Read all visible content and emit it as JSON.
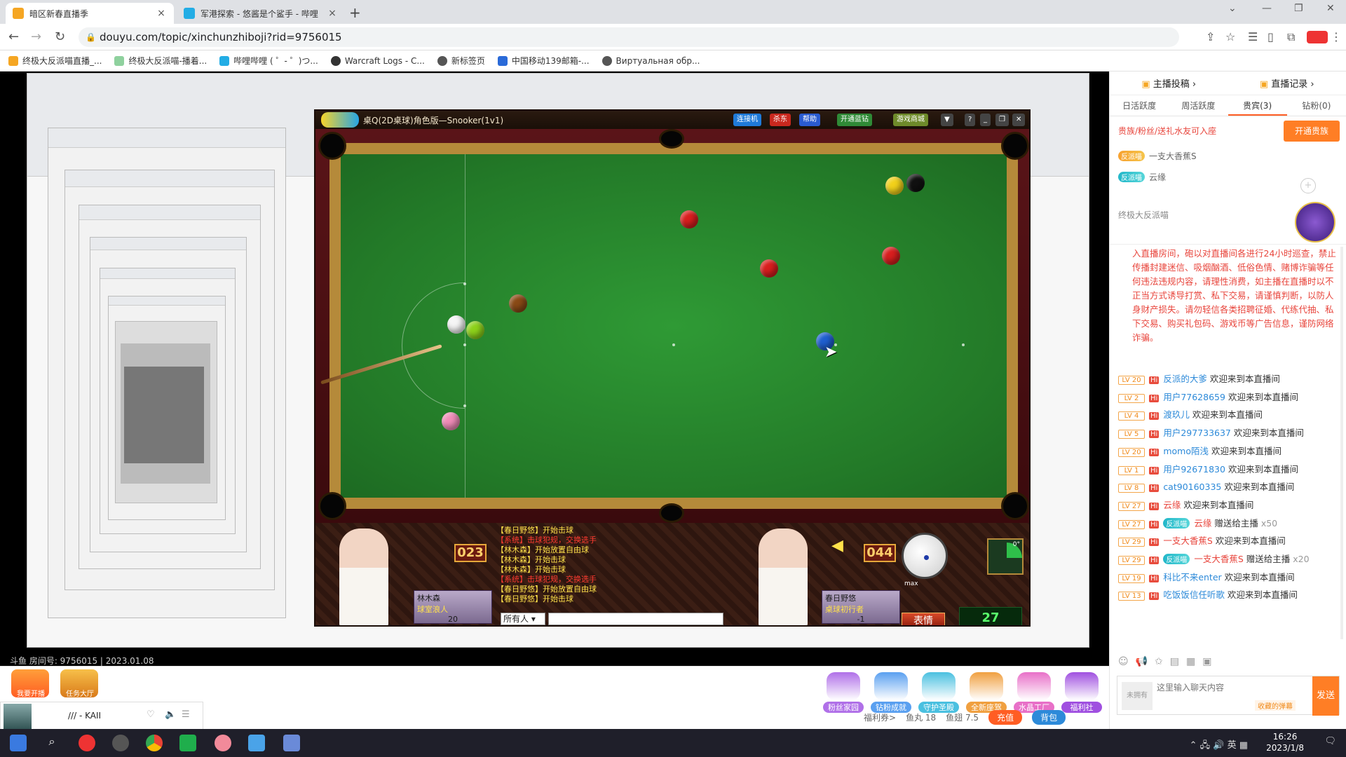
{
  "browser": {
    "tabs": [
      {
        "title": "暗区新春直播季",
        "active": true
      },
      {
        "title": "军港探索 - 悠酱是个鲨手 - 哔哩",
        "active": false
      }
    ],
    "new_tab": "+",
    "url": "douyu.com/topic/xinchunzhiboji?rid=9756015",
    "bookmarks": [
      "终极大反派喵直播_...",
      "终极大反派喵-播着...",
      "哔哩哔哩 ( ゜- ゜)つ...",
      "Warcraft Logs - C...",
      "新标签页",
      "中国移动139邮箱-...",
      "Виртуальная обр..."
    ]
  },
  "game": {
    "title": "桌Q(2D桌球)角色版—Snooker(1v1)",
    "buttons": [
      "连接机",
      "杀东",
      "帮助",
      "开通蓝钻",
      "游戏商城"
    ],
    "player_left": {
      "name": "林木森",
      "title": "球室浪人",
      "coins": "20",
      "score": "023"
    },
    "player_right": {
      "name": "春日野悠",
      "title": "桌球初行者",
      "coins": "-1",
      "score": "044"
    },
    "log": [
      {
        "text": "【春日野悠】开始击球",
        "color": "#ffe14a"
      },
      {
        "text": "【系统】击球犯规，交换选手",
        "color": "#ff3b30"
      },
      {
        "text": "【林木森】开始放置自由球",
        "color": "#ffe14a"
      },
      {
        "text": "【林木森】开始击球",
        "color": "#ffe14a"
      },
      {
        "text": "【林木森】开始击球",
        "color": "#ffe14a"
      },
      {
        "text": "【系统】击球犯规，交换选手",
        "color": "#ff3b30"
      },
      {
        "text": "【春日野悠】开始放置自由球",
        "color": "#ffe14a"
      },
      {
        "text": "【春日野悠】开始击球",
        "color": "#ffe14a"
      }
    ],
    "chat_target": "所有人",
    "emote_button": "表情",
    "timer": "27",
    "power_label": "max",
    "angle_label": "0°"
  },
  "stage_overlay": {
    "room_id": "斗鱼 房间号: 9756015 | 2023.01.08"
  },
  "right_panel": {
    "top_links": [
      "主播投稿",
      "直播记录"
    ],
    "tabs": [
      "日活跃度",
      "周活跃度",
      "贵宾(3)",
      "钻粉(0)"
    ],
    "vip_hint": "贵族/粉丝/送礼水友可入座",
    "vip_button": "开通贵族",
    "vip_users": [
      {
        "badge": "反派喵",
        "name": "一支大香蕉S",
        "teal": false
      },
      {
        "badge": "反派喵",
        "name": "云缘",
        "teal": true
      }
    ],
    "host_name": "终极大反派喵",
    "notice": "入直播房间，砲以对直播间各进行24小时巡查，禁止传播封建迷信、吸烟酗酒、低俗色情、赌博诈骗等任何违法违规内容，请理性消费，如主播在直播时以不正当方式诱导打赏、私下交易，请谨慎判断，以防人身财产损失。请勿轻信各类招聘征婚、代练代抽、私下交易、购买礼包码、游戏币等广告信息，谨防网络诈骗。",
    "messages": [
      {
        "lv": "LV 20",
        "user": "反派的大爹",
        "text": "欢迎来到本直播间",
        "fan": "",
        "red": false
      },
      {
        "lv": "LV 2",
        "user": "用户77628659",
        "text": "欢迎来到本直播间",
        "fan": "",
        "red": false
      },
      {
        "lv": "LV 4",
        "user": "渡玖儿",
        "text": "欢迎来到本直播间",
        "fan": "",
        "red": false
      },
      {
        "lv": "LV 5",
        "user": "用户297733637",
        "text": "欢迎来到本直播间",
        "fan": "",
        "red": false
      },
      {
        "lv": "LV 20",
        "user": "momo陌浅",
        "text": "欢迎来到本直播间",
        "fan": "",
        "red": false
      },
      {
        "lv": "LV 1",
        "user": "用户92671830",
        "text": "欢迎来到本直播间",
        "fan": "",
        "red": false
      },
      {
        "lv": "LV 8",
        "user": "cat90160335",
        "text": "欢迎来到本直播间",
        "fan": "",
        "red": false
      },
      {
        "lv": "LV 27",
        "user": "云缘",
        "text": "欢迎来到本直播间",
        "fan": "",
        "red": true
      },
      {
        "lv": "LV 27",
        "user": "云缘",
        "text": "赠送给主播",
        "fan": "反派喵",
        "extra": "x50",
        "red": true
      },
      {
        "lv": "LV 29",
        "user": "一支大香蕉S",
        "text": "欢迎来到本直播间",
        "fan": "",
        "red": true
      },
      {
        "lv": "LV 29",
        "user": "一支大香蕉S",
        "text": "赠送给主播",
        "fan": "反派喵",
        "extra": "x20",
        "red": true
      },
      {
        "lv": "LV 19",
        "user": "科比不来enter",
        "text": "欢迎来到本直播间",
        "fan": "",
        "red": false
      },
      {
        "lv": "LV 13",
        "user": "吃饭饭信任听歌",
        "text": "欢迎来到本直播间",
        "fan": "",
        "red": false
      }
    ],
    "chat_placeholder": "这里输入聊天内容",
    "chat_hint": "收藏的弹幕",
    "chat_badge": "未拥有",
    "send_label": "发送"
  },
  "bottom_bar": {
    "gifts": [
      "粉丝家园",
      "钻粉成就",
      "守护圣殿",
      "全新座驾",
      "水晶工厂",
      "福利社"
    ],
    "left_buttons": [
      "我要开播",
      "任务大厅"
    ],
    "music_title": "/// - KAII",
    "wallet": {
      "benefit": "福利券>",
      "fishball": "鱼丸 18",
      "fishwing": "鱼翅 7.5",
      "recharge": "充值",
      "bag": "背包"
    }
  },
  "taskbar": {
    "time": "16:26",
    "date": "2023/1/8",
    "lang": "英"
  },
  "colors": {
    "accent": "#ff5d23",
    "felt": "#237a28",
    "rail": "#5a1418"
  }
}
